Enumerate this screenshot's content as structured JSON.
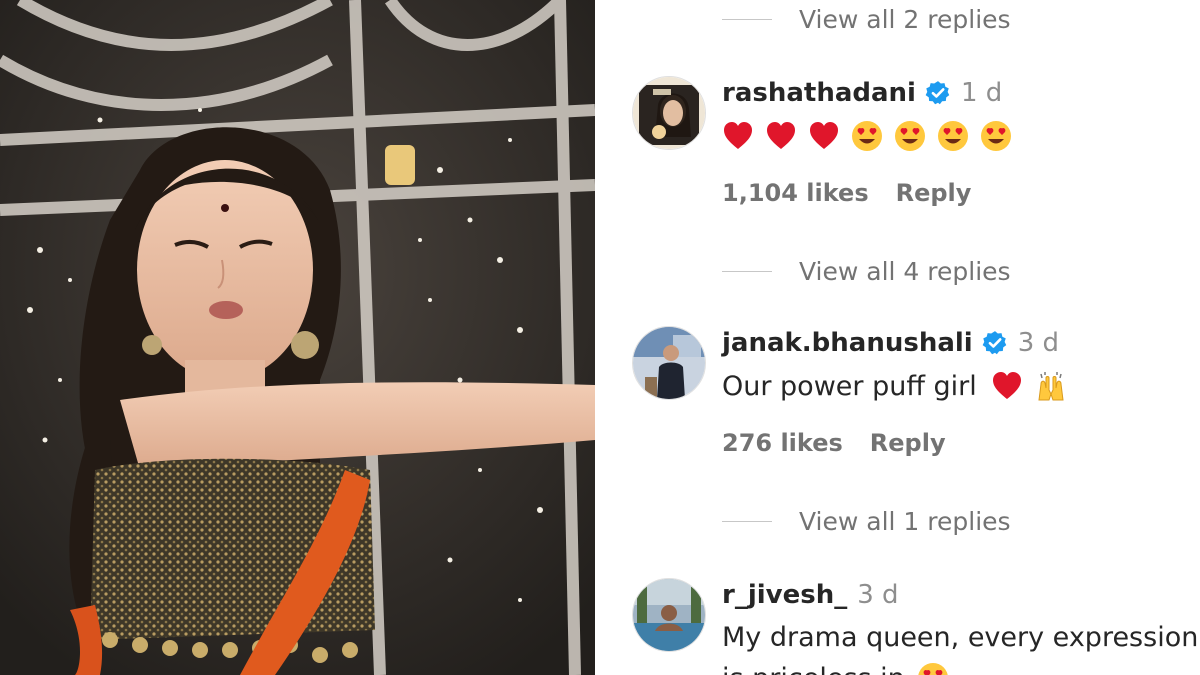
{
  "comments": [
    {
      "username": "rashathadani",
      "verified": true,
      "time": "1 d",
      "text": "",
      "emojis": [
        "red-heart",
        "red-heart",
        "red-heart",
        "heart-eyes",
        "heart-eyes",
        "heart-eyes",
        "heart-eyes"
      ],
      "likes": "1,104 likes",
      "reply_label": "Reply",
      "view_replies": "View all 4 replies"
    },
    {
      "username": "janak.bhanushali",
      "verified": true,
      "time": "3 d",
      "text": "Our power puff girl",
      "emojis": [
        "red-heart",
        "raising-hands"
      ],
      "likes": "276 likes",
      "reply_label": "Reply",
      "view_replies": "View all 1 replies"
    },
    {
      "username": "r_jivesh_",
      "verified": false,
      "time": "3 d",
      "text": "My drama queen, every expression",
      "text_line2": "is priceless in",
      "emojis": [
        "heart-eyes"
      ]
    }
  ],
  "top_view_replies": "View all 2 replies",
  "colors": {
    "verified_blue": "#1d9bf0",
    "muted_text": "#737373",
    "primary_text": "#262626"
  }
}
